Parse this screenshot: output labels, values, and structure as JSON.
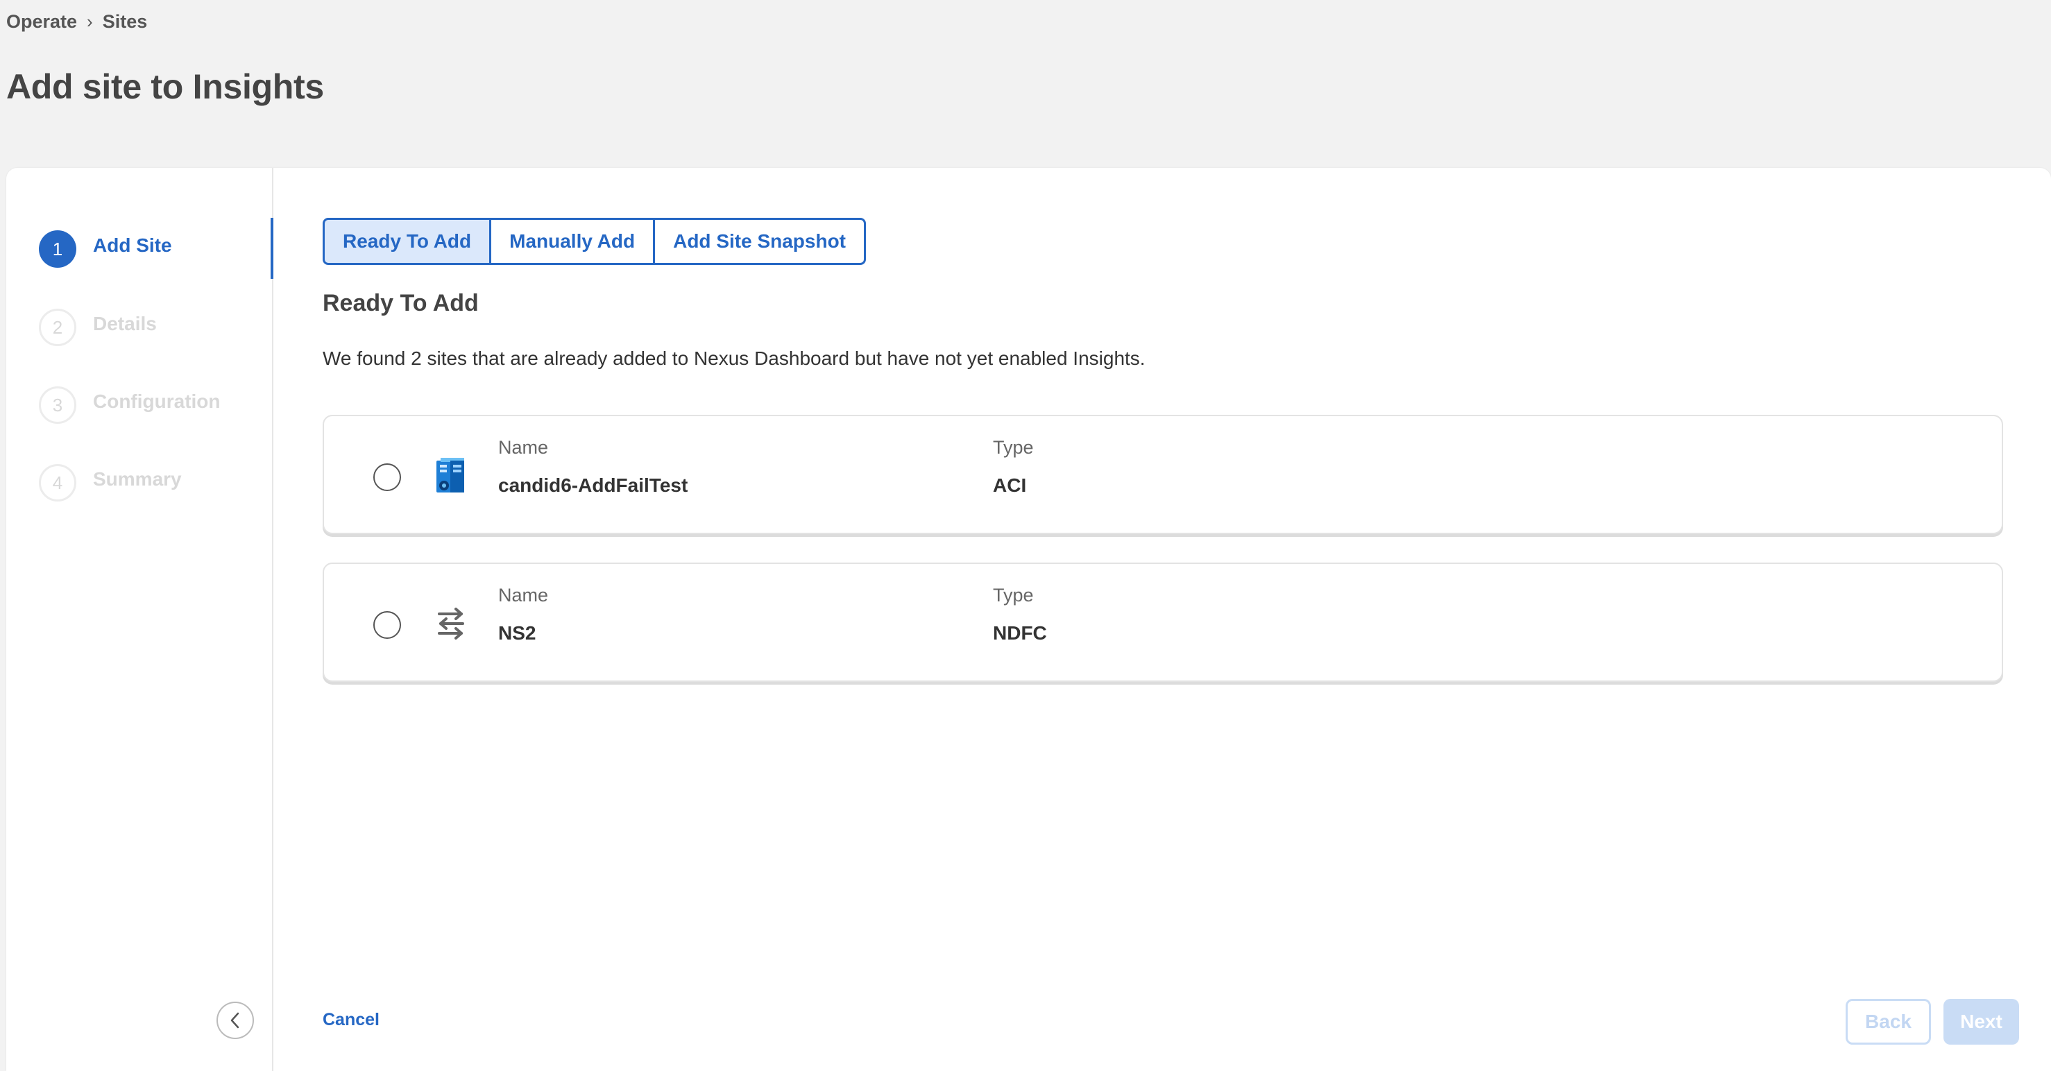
{
  "breadcrumb": {
    "items": [
      "Operate",
      "Sites"
    ],
    "separator": "›"
  },
  "page": {
    "title": "Add site to Insights"
  },
  "wizard": {
    "steps": [
      {
        "number": "1",
        "label": "Add Site",
        "state": "active"
      },
      {
        "number": "2",
        "label": "Details",
        "state": "inactive"
      },
      {
        "number": "3",
        "label": "Configuration",
        "state": "inactive"
      },
      {
        "number": "4",
        "label": "Summary",
        "state": "inactive"
      }
    ]
  },
  "tabs": [
    {
      "label": "Ready To Add",
      "selected": true
    },
    {
      "label": "Manually Add",
      "selected": false
    },
    {
      "label": "Add Site Snapshot",
      "selected": false
    }
  ],
  "section": {
    "title": "Ready To Add",
    "description": "We found 2 sites that are already added to Nexus Dashboard but have not yet enabled Insights."
  },
  "columns": {
    "name": "Name",
    "type": "Type"
  },
  "sites": [
    {
      "name": "candid6-AddFailTest",
      "type": "ACI",
      "icon": "aci-site-icon",
      "selected": false
    },
    {
      "name": "NS2",
      "type": "NDFC",
      "icon": "ndfc-site-icon",
      "selected": false
    }
  ],
  "footer": {
    "cancel_label": "Cancel",
    "back_label": "Back",
    "next_label": "Next"
  },
  "colors": {
    "accent": "#2567c4",
    "tab_selected_bg": "#dbe8fb",
    "disabled_button": "#c9dcf5"
  }
}
